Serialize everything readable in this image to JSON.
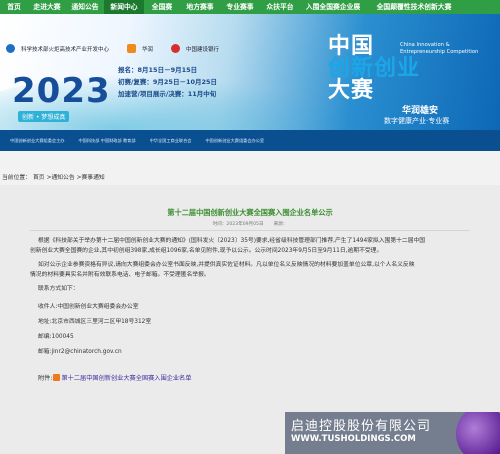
{
  "nav": {
    "items": [
      "首页",
      "走进大赛",
      "通知公告",
      "新闻中心",
      "全国赛",
      "地方赛事",
      "专业赛事",
      "众扶平台",
      "入围全国赛企业展",
      "全国颠覆性技术创新大赛"
    ],
    "active_index": 3
  },
  "banner": {
    "logo1": "科学技术部火炬高技术产业开发中心",
    "logo2": "华润",
    "logo3": "中国建设银行",
    "dates_line1": "报名：8月15日－9月15日",
    "dates_line2": "初赛/复赛：9月25日－10月25日",
    "dates_line3": "加速营/项目展示/决赛：11月中旬",
    "year": "2023",
    "slogan": "创新 • 梦想成真",
    "orgs": [
      "中国创新创业大赛组委会主办",
      "中国科技部 中国财政部 教育部",
      "中华全国工商业联合会",
      "中国创新创业大赛组委会办公室"
    ],
    "title_line1": "中国",
    "title_line2": "创新创业",
    "title_line3": "大赛",
    "title_en": "China Innovation & Entrepreneurship Competition",
    "sub1": "华润雄安",
    "sub2": "数字健康产业·专业赛"
  },
  "breadcrumb": {
    "prefix": "当前位置：",
    "items": [
      "首页",
      ">通知公告",
      ">赛事通知"
    ]
  },
  "article": {
    "title": "第十二届中国创新创业大赛全国赛入围企业名单公示",
    "meta_time": "时间：2023年09月05日",
    "meta_source": "来源：",
    "p1_line1": "根据《科技部关于举办第十二届中国创新创业大赛的通知》(国科发火〔2023〕35号)要求,经省级科技管理部门推荐,产生了1494家拟入围第十二届中国",
    "p1_line2": "创新创业大赛全国赛的企业,其中初创组398家,成长组1096家,名单见附件,现予以公示。公示时间2023年9月5日至9月11日,逾期不受理。",
    "p2_line1": "如对公示企业参赛资格有异议,请向大赛组委会办公室书面反映,并提供真实佐证材料。凡以单位名义反映情况的材料要加盖单位公章,以个人名义反映",
    "p2_line2": "情况的材料要具实名并附有效联系电话、电子邮箱。不受理匿名举报。",
    "contact_heading": "联系方式如下：",
    "recipient": "收件人:中国创新创业大赛组委会办公室",
    "address": "地址:北京市西城区三里河二区甲18号312室",
    "zip_label": "邮编:100045",
    "email_label": "邮箱:jinr2@chinatorch.gov.cn",
    "attachment_label": "附件:",
    "attachment_link": "第十二届中国创新创业大赛全国赛入围企业名单"
  },
  "watermark": {
    "line1": "启迪控股股份有限公司",
    "line2": "WWW.TUSHOLDINGS.COM"
  },
  "colors": {
    "nav_green": "#2f9e44",
    "title_green": "#3b8e2f",
    "banner_blue": "#0c66b5"
  }
}
